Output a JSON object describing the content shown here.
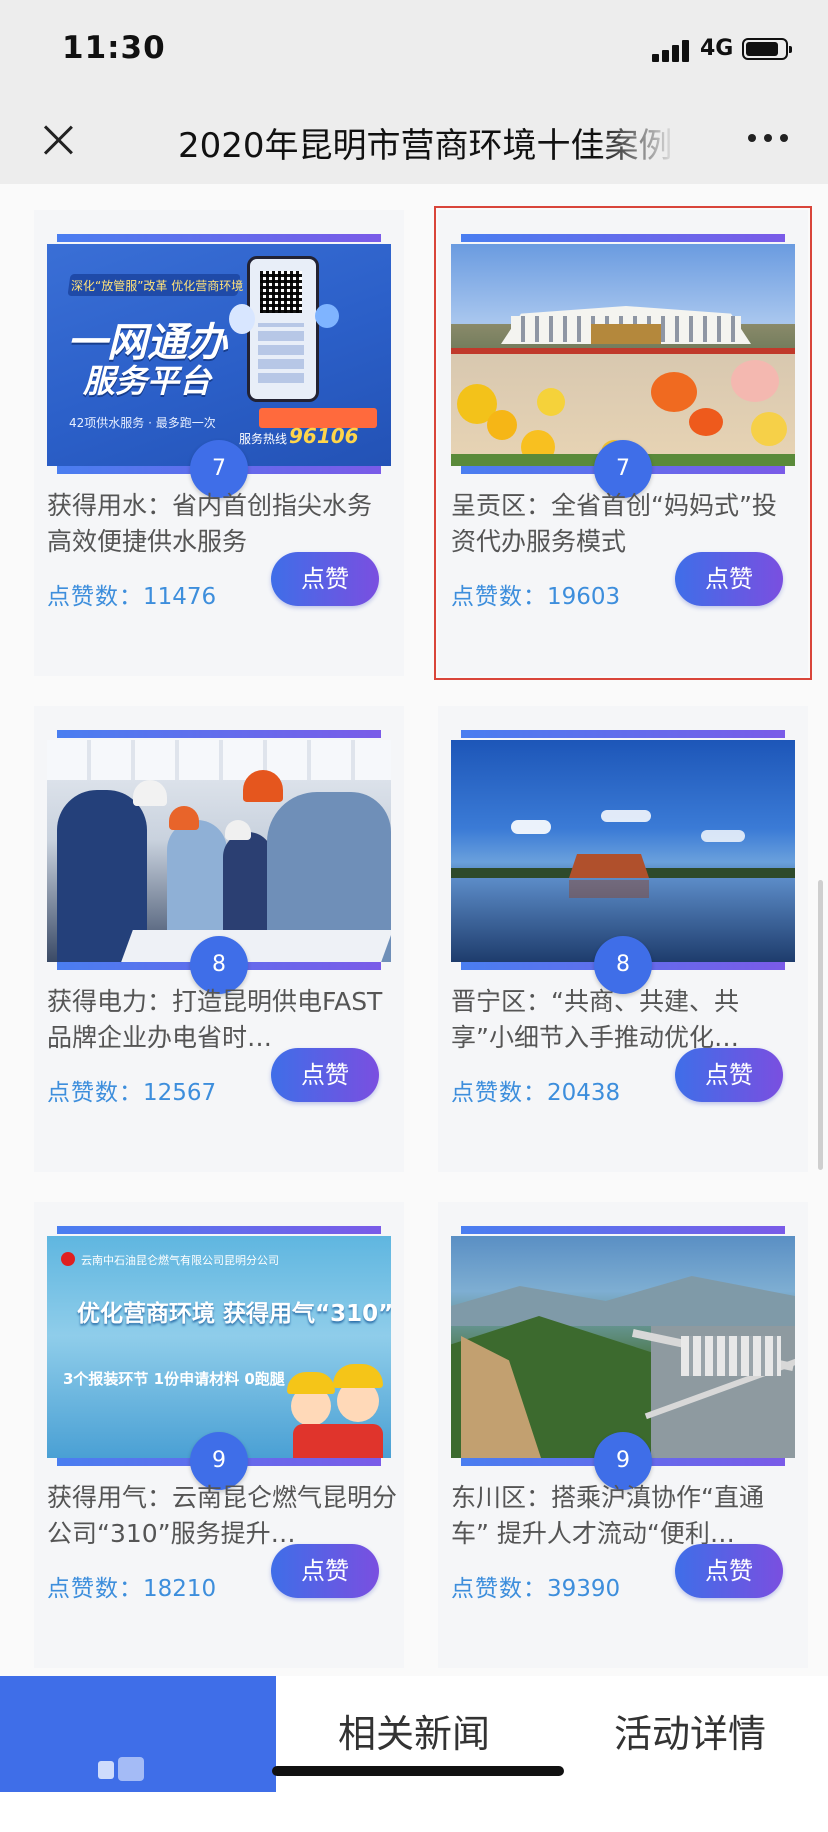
{
  "status_bar": {
    "time": "11:30",
    "network": "4G",
    "battery_level": 0.85
  },
  "nav_bar": {
    "title": "2020年昆明市营商环境十佳案例"
  },
  "cards": [
    {
      "rank": "7",
      "title": "获得用水：省内首创指尖水务 高效便捷供水服务",
      "likes_label": "点赞数：",
      "likes": "11476",
      "button": "点赞",
      "selected": false,
      "image_text": {
        "line1": "深化“放管服”改革 优化营商环境",
        "line2": "一网通办",
        "line3": "服务平台",
        "line4": "42项供水服务 · 最多跑一次",
        "hotline_label": "服务热线",
        "hotline": "96106"
      }
    },
    {
      "rank": "7",
      "title": "呈贡区：全省首创“妈妈式”投资代办服务模式",
      "likes_label": "点赞数：",
      "likes": "19603",
      "button": "点赞",
      "selected": true
    },
    {
      "rank": "8",
      "title": "获得电力：打造昆明供电FAST品牌企业办电省时…",
      "likes_label": "点赞数：",
      "likes": "12567",
      "button": "点赞",
      "selected": false
    },
    {
      "rank": "8",
      "title": "晋宁区：“共商、共建、共享”小细节入手推动优化…",
      "likes_label": "点赞数：",
      "likes": "20438",
      "button": "点赞",
      "selected": false
    },
    {
      "rank": "9",
      "title": "获得用气：云南昆仑燃气昆明分公司“310”服务提升…",
      "likes_label": "点赞数：",
      "likes": "18210",
      "button": "点赞",
      "selected": false,
      "image_text": {
        "company": "云南中石油昆仑燃气有限公司昆明分公司",
        "headline": "优化营商环境 获得用气“310”",
        "subline": "3个报装环节 1份申请材料 0跑腿"
      }
    },
    {
      "rank": "9",
      "title": "东川区：搭乘沪滇协作“直通车” 提升人才流动“便利…",
      "likes_label": "点赞数：",
      "likes": "39390",
      "button": "点赞",
      "selected": false
    }
  ],
  "tabs": [
    {
      "label": "",
      "active": true
    },
    {
      "label": "相关新闻",
      "active": false
    },
    {
      "label": "活动详情",
      "active": false
    }
  ],
  "colors": {
    "accent": "#3f6ee8",
    "likes_text": "#3d8edc",
    "selected_border": "#d9453a"
  }
}
